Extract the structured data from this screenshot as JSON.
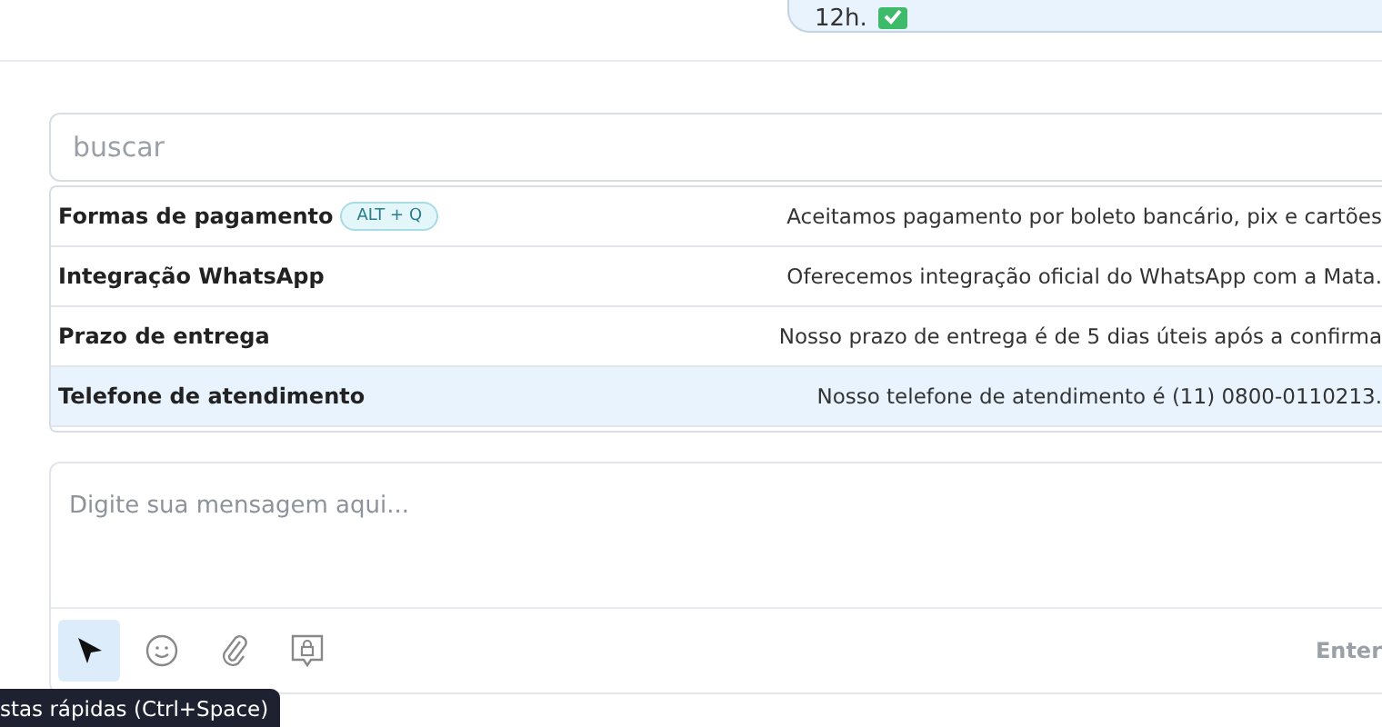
{
  "message": {
    "text": "12h."
  },
  "search": {
    "placeholder": "buscar"
  },
  "quick_replies": [
    {
      "title": "Formas de pagamento",
      "shortcut": "ALT + Q",
      "text": "Aceitamos pagamento por boleto bancário, pix e cartões",
      "selected": false
    },
    {
      "title": "Integração WhatsApp",
      "text": "Oferecemos integração oficial do WhatsApp com a Mata.",
      "selected": false
    },
    {
      "title": "Prazo de entrega",
      "text": "Nosso prazo de entrega é de 5 dias úteis após a confirma",
      "selected": false
    },
    {
      "title": "Telefone de atendimento",
      "text": "Nosso telefone de atendimento é (11) 0800-0110213.",
      "selected": true
    }
  ],
  "composer": {
    "placeholder": "Digite sua mensagem aqui...",
    "hint": "Enter"
  },
  "tooltip": {
    "text": "stas rápidas (Ctrl+Space)"
  }
}
